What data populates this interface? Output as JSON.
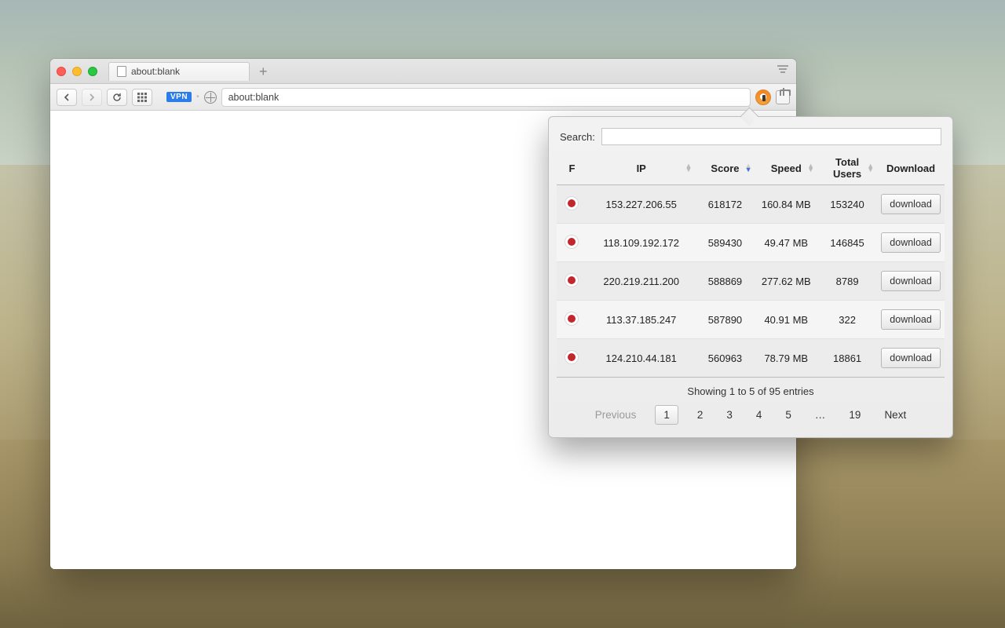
{
  "tab": {
    "title": "about:blank"
  },
  "addressbar": {
    "url": "about:blank",
    "vpn_badge": "VPN"
  },
  "popover": {
    "search_label": "Search:",
    "search_value": "",
    "columns": {
      "flag": "F",
      "ip": "IP",
      "score": "Score",
      "speed": "Speed",
      "total_users": "Total Users",
      "download": "Download"
    },
    "download_button_label": "download",
    "rows": [
      {
        "flag": "jp",
        "ip": "153.227.206.55",
        "score": "618172",
        "speed": "160.84 MB",
        "total_users": "153240"
      },
      {
        "flag": "jp",
        "ip": "118.109.192.172",
        "score": "589430",
        "speed": "49.47 MB",
        "total_users": "146845"
      },
      {
        "flag": "jp",
        "ip": "220.219.211.200",
        "score": "588869",
        "speed": "277.62 MB",
        "total_users": "8789"
      },
      {
        "flag": "jp",
        "ip": "113.37.185.247",
        "score": "587890",
        "speed": "40.91 MB",
        "total_users": "322"
      },
      {
        "flag": "jp",
        "ip": "124.210.44.181",
        "score": "560963",
        "speed": "78.79 MB",
        "total_users": "18861"
      }
    ],
    "status": "Showing 1 to 5 of 95 entries",
    "pager": {
      "previous": "Previous",
      "next": "Next",
      "ellipsis": "…",
      "pages": [
        "1",
        "2",
        "3",
        "4",
        "5"
      ],
      "last_page": "19",
      "current": "1"
    }
  }
}
